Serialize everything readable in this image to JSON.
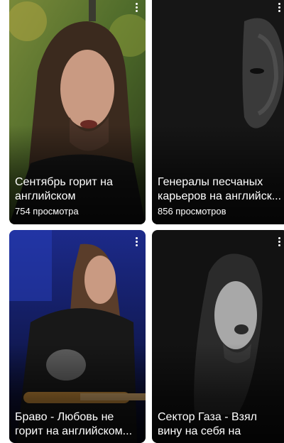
{
  "videos": [
    {
      "title": "Сентябрь горит на английском",
      "views": "754 просмотра"
    },
    {
      "title": "Генералы песчаных карьеров на английск...",
      "views": "856 просмотров"
    },
    {
      "title": "Браво - Любовь не горит на английском...",
      "views": ""
    },
    {
      "title": "Сектор Газа - Взял вину на себя на английском...",
      "views": ""
    }
  ],
  "icons": {
    "more": "more-vert-icon"
  }
}
